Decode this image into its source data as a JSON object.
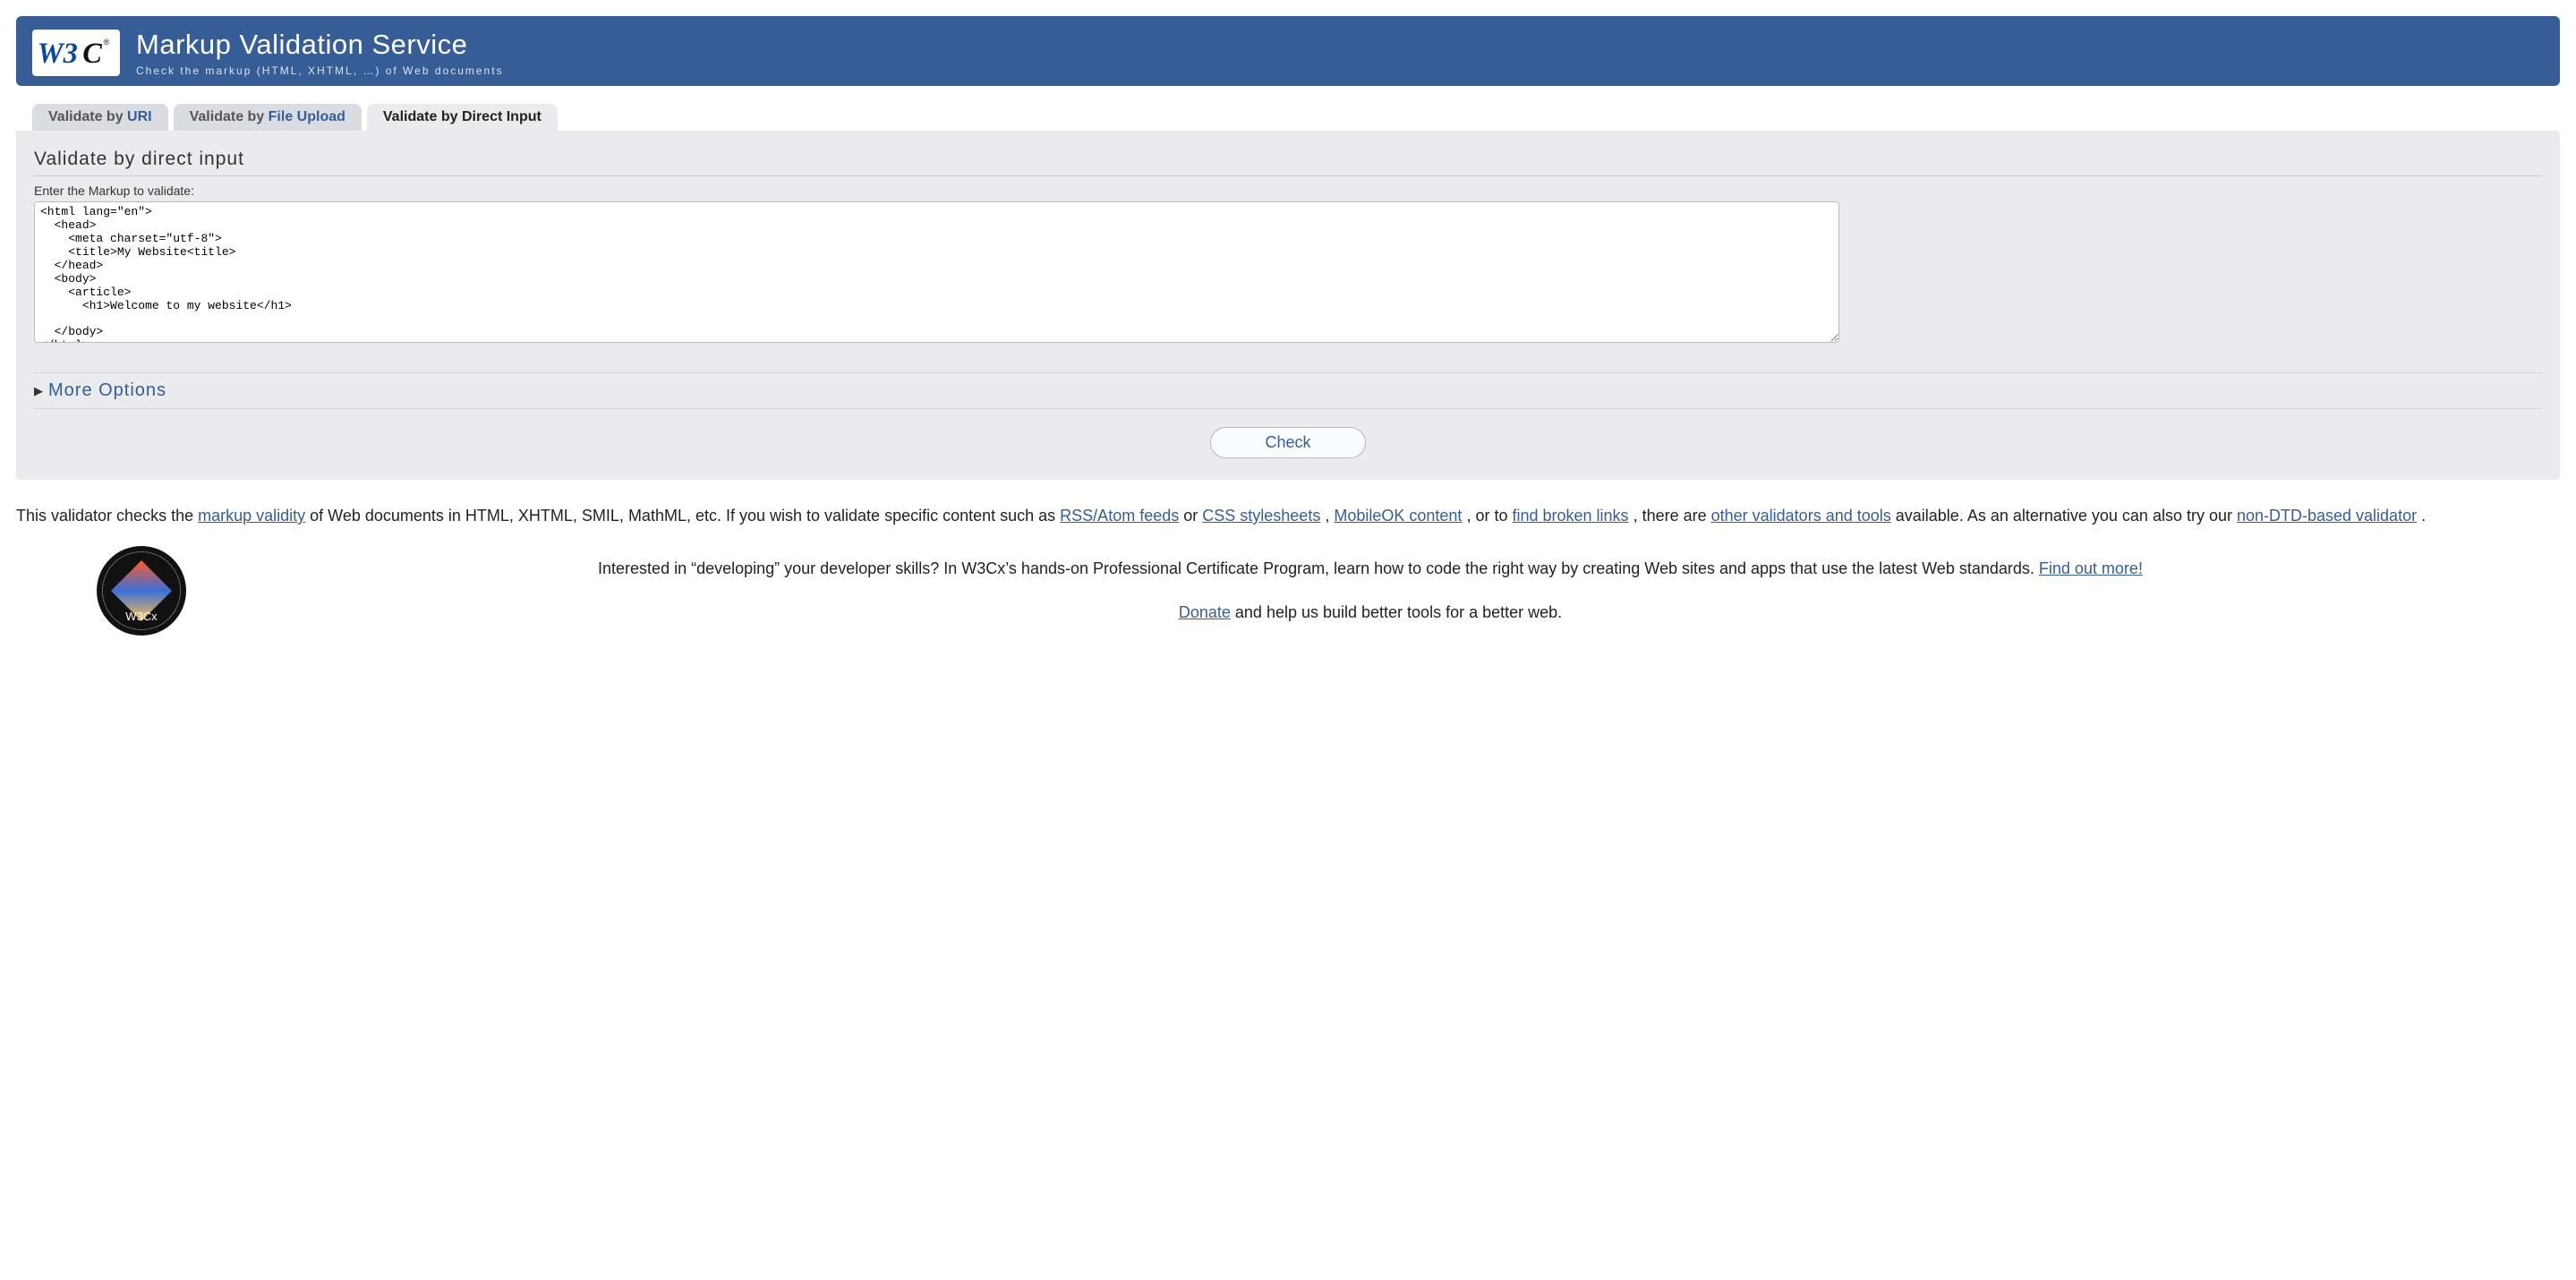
{
  "header": {
    "title": "Markup Validation Service",
    "subtitle": "Check the markup (HTML, XHTML, …) of Web documents",
    "logo_alt": "W3C"
  },
  "tabs": {
    "uri": {
      "prefix": "Validate by ",
      "link": "URI"
    },
    "file": {
      "prefix": "Validate by ",
      "link": "File Upload"
    },
    "input": {
      "prefix": "Validate by ",
      "link": "Direct Input"
    }
  },
  "form": {
    "heading": "Validate by direct input",
    "label": "Enter the Markup to validate:",
    "markup": "<html lang=\"en\">\n  <head>\n    <meta charset=\"utf-8\">\n    <title>My Website<title>\n  </head>\n  <body>\n    <article>\n      <h1>Welcome to my website</h1>\n\n  </body>\n</html>",
    "more_options": "More Options",
    "check": "Check"
  },
  "description": {
    "t0": "This validator checks the ",
    "l0": "markup validity",
    "t1": " of Web documents in HTML, XHTML, SMIL, MathML, etc. If you wish to validate specific content such as ",
    "l1": "RSS/Atom feeds",
    "t2": " or ",
    "l2": "CSS stylesheets",
    "t3": ", ",
    "l3": "MobileOK content",
    "t4": ", or to ",
    "l4": "find broken links",
    "t5": ", there are ",
    "l5": "other validators and tools",
    "t6": " available. As an alternative you can also try our ",
    "l6": "non-DTD-based validator",
    "t7": "."
  },
  "promo": {
    "badge_label": "W3Cx",
    "text_before": "Interested in “developing” your developer skills? In W3Cx’s hands-on Professional Certificate Program, learn how to code the right way by creating Web sites and apps that use the latest Web standards. ",
    "link": "Find out more!"
  },
  "donate": {
    "link": "Donate",
    "after": " and help us build better tools for a better web."
  }
}
